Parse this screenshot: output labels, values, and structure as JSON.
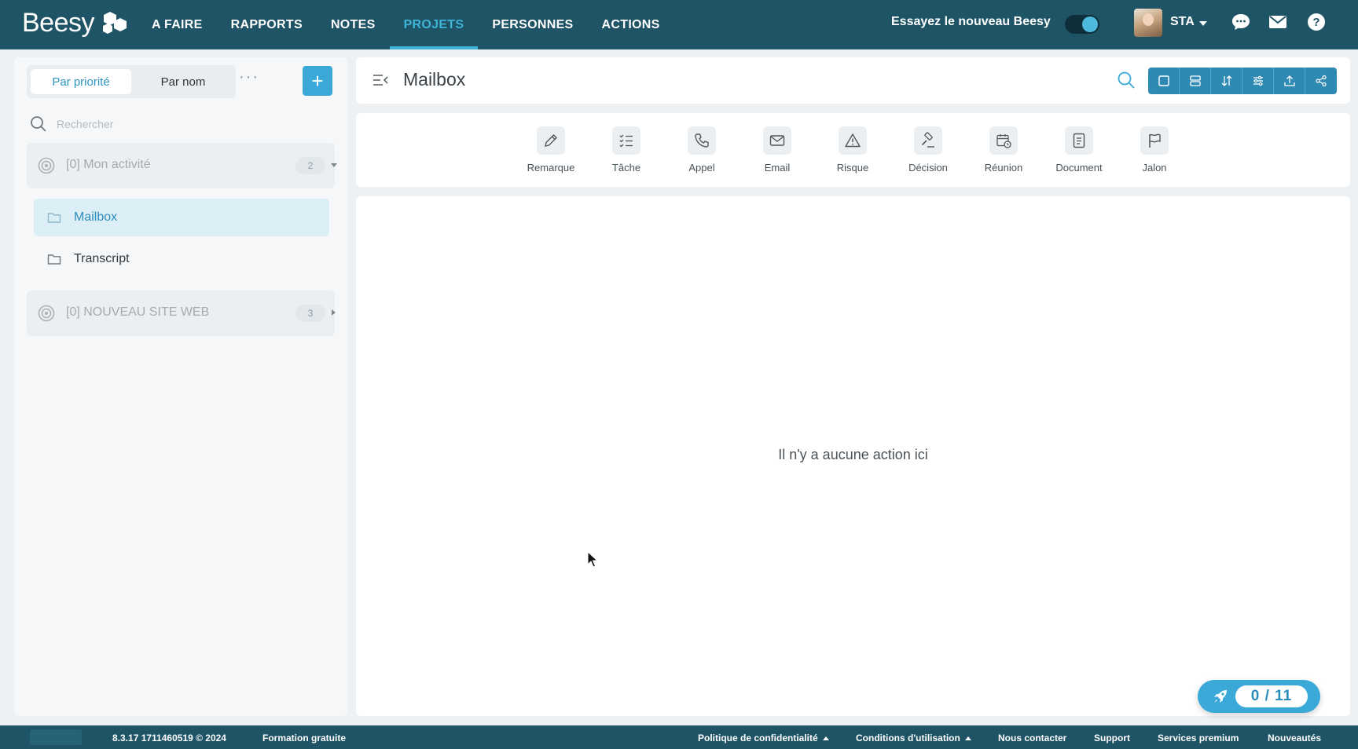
{
  "app": {
    "logo_text": "Beesy"
  },
  "nav": {
    "items": [
      {
        "label": "A FAIRE"
      },
      {
        "label": "RAPPORTS"
      },
      {
        "label": "NOTES"
      },
      {
        "label": "PROJETS",
        "active": true
      },
      {
        "label": "PERSONNES"
      },
      {
        "label": "ACTIONS"
      }
    ]
  },
  "topbar": {
    "try_new_label": "Essayez le nouveau Beesy",
    "toggle_on": true,
    "user_initials": "STA",
    "icons": [
      "chat-icon",
      "mail-icon",
      "help-icon"
    ]
  },
  "sidebar": {
    "sort_tabs": [
      {
        "label": "Par priorité",
        "active": true
      },
      {
        "label": "Par nom"
      }
    ],
    "more_label": "···",
    "add_label": "+",
    "search_placeholder": "Rechercher",
    "groups": [
      {
        "title": "[0] Mon activité",
        "count": "2",
        "expanded": true,
        "items": [
          {
            "label": "Mailbox",
            "active": true
          },
          {
            "label": "Transcript"
          }
        ]
      },
      {
        "title": "[0] NOUVEAU SITE WEB",
        "count": "3",
        "expanded": false
      }
    ]
  },
  "main": {
    "title": "Mailbox",
    "toolbar_icons": [
      "single-view-icon",
      "list-view-icon",
      "sort-icon",
      "filter-icon",
      "export-icon",
      "share-icon"
    ],
    "actions": [
      {
        "label": "Remarque",
        "icon": "pencil-icon"
      },
      {
        "label": "Tâche",
        "icon": "checklist-icon"
      },
      {
        "label": "Appel",
        "icon": "phone-icon"
      },
      {
        "label": "Email",
        "icon": "envelope-icon"
      },
      {
        "label": "Risque",
        "icon": "warning-icon"
      },
      {
        "label": "Décision",
        "icon": "gavel-icon"
      },
      {
        "label": "Réunion",
        "icon": "calendar-clock-icon"
      },
      {
        "label": "Document",
        "icon": "document-icon"
      },
      {
        "label": "Jalon",
        "icon": "flag-icon"
      }
    ],
    "empty_message": "Il n'y a aucune action ici"
  },
  "progress": {
    "label": "0 / 11"
  },
  "footer": {
    "version": "8.3.17 1711460519 © 2024",
    "links": [
      {
        "label": "Formation gratuite"
      },
      {
        "label": "Politique de confidentialité"
      },
      {
        "label": "Conditions d'utilisation"
      },
      {
        "label": "Nous contacter"
      },
      {
        "label": "Support"
      },
      {
        "label": "Services premium"
      },
      {
        "label": "Nouveautés"
      }
    ]
  },
  "colors": {
    "topbar_bg": "#1e5466",
    "accent": "#3aa9d8",
    "active_nav": "#3fb3d6"
  }
}
